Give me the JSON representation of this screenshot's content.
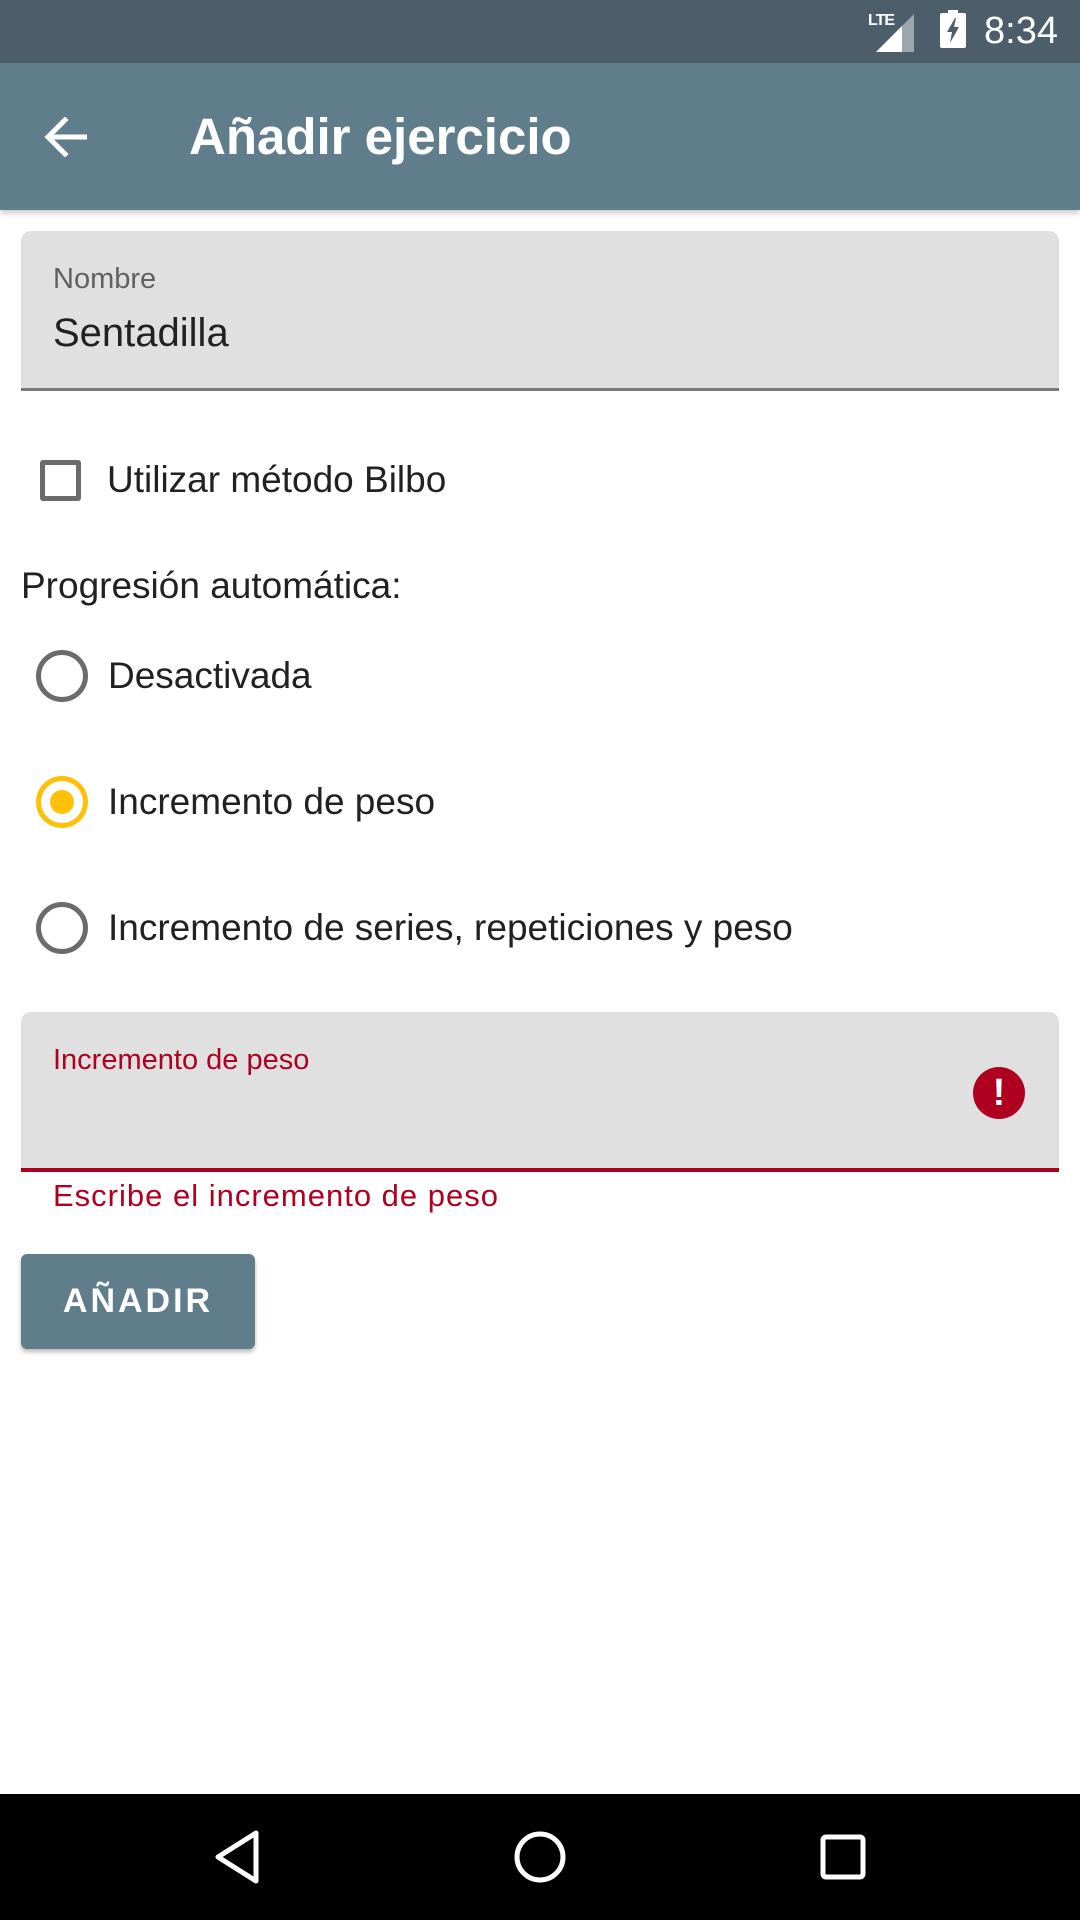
{
  "status_bar": {
    "network": "LTE",
    "time": "8:34",
    "icons": [
      "lte-signal-icon",
      "battery-charging-icon"
    ]
  },
  "app_bar": {
    "back_icon": "arrow-left-icon",
    "title": "Añadir ejercicio"
  },
  "form": {
    "name_field": {
      "label": "Nombre",
      "value": "Sentadilla"
    },
    "bilbo_checkbox": {
      "label": "Utilizar método Bilbo",
      "checked": false
    },
    "progression": {
      "title": "Progresión automática:",
      "options": [
        {
          "label": "Desactivada",
          "selected": false
        },
        {
          "label": "Incremento de peso",
          "selected": true
        },
        {
          "label": "Incremento de series, repeticiones y peso",
          "selected": false
        }
      ]
    },
    "increment_field": {
      "label": "Incremento de peso",
      "value": "",
      "error_icon": "!",
      "error_message": "Escribe el incremento de peso"
    },
    "add_button_label": "AÑADIR"
  },
  "colors": {
    "status_bar": "#4b5e6a",
    "app_bar": "#607d8b",
    "radio_selected": "#ffc107",
    "error": "#b00020",
    "field_background": "#e0e0e0"
  },
  "nav_bar": {
    "icons": [
      "back-triangle-icon",
      "home-circle-icon",
      "recents-square-icon"
    ]
  }
}
